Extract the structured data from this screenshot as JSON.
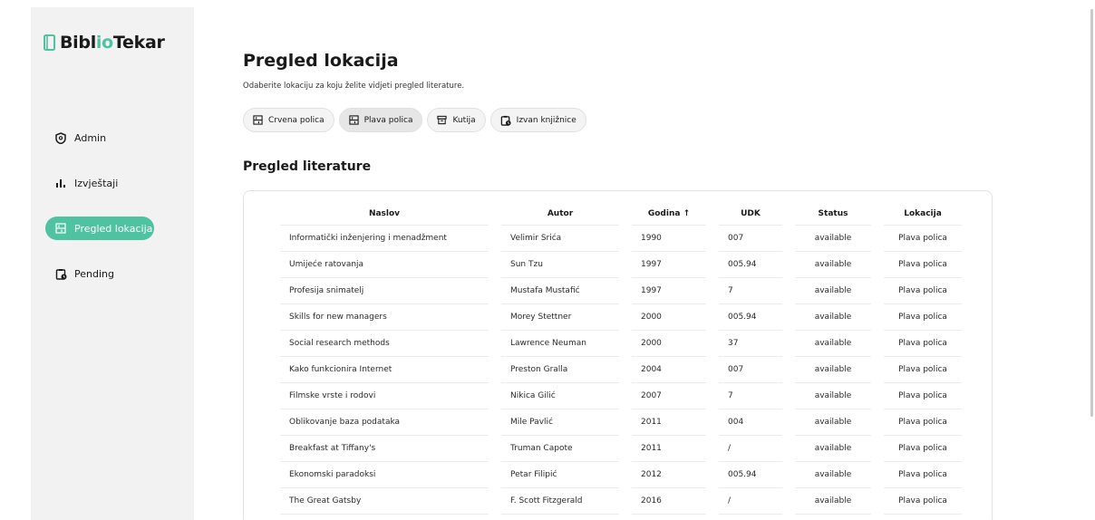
{
  "app": {
    "logo_part1": "Bibl",
    "logo_part2": "io",
    "logo_part3": "Tekar"
  },
  "sidebar": {
    "items": [
      {
        "label": "Admin",
        "icon": "shield-icon"
      },
      {
        "label": "Izvještaji",
        "icon": "bar-chart-icon"
      },
      {
        "label": "Pregled lokacija",
        "icon": "shelf-icon",
        "active": true
      },
      {
        "label": "Pending",
        "icon": "clipboard-clock-icon"
      }
    ]
  },
  "main": {
    "title": "Pregled lokacija",
    "subtitle": "Odaberite lokaciju za koju želite vidjeti pregled literature.",
    "chips": [
      {
        "label": "Crvena polica",
        "icon": "shelf-icon"
      },
      {
        "label": "Plava polica",
        "icon": "shelf-icon",
        "active": true
      },
      {
        "label": "Kutija",
        "icon": "archive-box-icon"
      },
      {
        "label": "Izvan knjižnice",
        "icon": "clipboard-clock-icon"
      }
    ],
    "section_title": "Pregled literature",
    "table": {
      "headers": [
        "Naslov",
        "Autor",
        "Godina ↑",
        "UDK",
        "Status",
        "Lokacija"
      ],
      "rows": [
        [
          "Informatički inženjering i menadžment",
          "Velimir Srića",
          "1990",
          "007",
          "available",
          "Plava polica"
        ],
        [
          "Umijeće ratovanja",
          "Sun Tzu",
          "1997",
          "005.94",
          "available",
          "Plava polica"
        ],
        [
          "Profesija snimatelj",
          "Mustafa Mustafić",
          "1997",
          "7",
          "available",
          "Plava polica"
        ],
        [
          "Skills for new managers",
          "Morey Stettner",
          "2000",
          "005.94",
          "available",
          "Plava polica"
        ],
        [
          "Social research methods",
          "Lawrence Neuman",
          "2000",
          "37",
          "available",
          "Plava polica"
        ],
        [
          "Kako funkcionira Internet",
          "Preston Gralla",
          "2004",
          "007",
          "available",
          "Plava polica"
        ],
        [
          "Filmske vrste i rodovi",
          "Nikica Gilić",
          "2007",
          "7",
          "available",
          "Plava polica"
        ],
        [
          "Oblikovanje baza podataka",
          "Mile Pavlić",
          "2011",
          "004",
          "available",
          "Plava polica"
        ],
        [
          "Breakfast at Tiffany's",
          "Truman Capote",
          "2011",
          "/",
          "available",
          "Plava polica"
        ],
        [
          "Ekonomski paradoksi",
          "Petar Filipić",
          "2012",
          "005.94",
          "available",
          "Plava polica"
        ],
        [
          "The Great Gatsby",
          "F. Scott Fitzgerald",
          "2016",
          "/",
          "available",
          "Plava polica"
        ]
      ]
    }
  },
  "colors": {
    "accent": "#4fc3a1",
    "sidebar_bg": "#f2f2f2"
  }
}
